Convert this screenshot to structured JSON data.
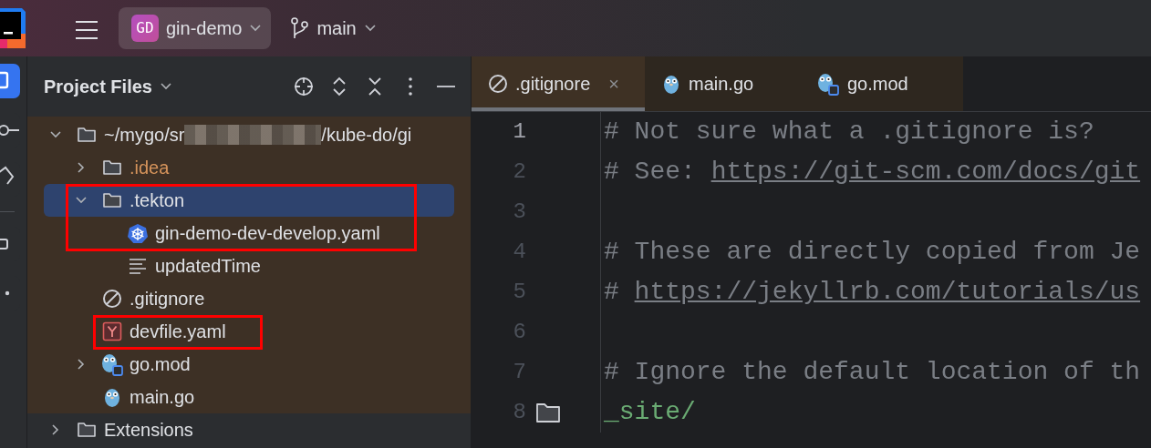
{
  "toolbar": {
    "project": {
      "badge": "GD",
      "name": "gin-demo"
    },
    "branch": "main"
  },
  "tool_strip": [
    {
      "kind": "project",
      "selected": true
    },
    {
      "kind": "commit",
      "selected": false
    },
    {
      "kind": "git",
      "selected": false
    },
    {
      "kind": "structure",
      "selected": false
    },
    {
      "kind": "more",
      "selected": false
    }
  ],
  "panel": {
    "title": "Project Files"
  },
  "tree": [
    {
      "kind": "folder",
      "label": "~/mygo/sr",
      "label_after_blur": "/kube-do/gi",
      "blurred": true,
      "scoped": true,
      "expanded": true,
      "selected": false,
      "outlined": false,
      "children": [
        {
          "kind": "folder",
          "label": ".idea",
          "ignored": true,
          "expanded": false,
          "selected": false,
          "outlined": false
        },
        {
          "kind": "folder",
          "label": ".tekton",
          "ignored": false,
          "expanded": true,
          "selected": true,
          "outlined": true,
          "children": [
            {
              "kind": "kubernetes",
              "label": "gin-demo-dev-develop.yaml",
              "ignored": false,
              "selected": false,
              "outlined": true
            },
            {
              "kind": "text",
              "label": "updatedTime",
              "ignored": false,
              "selected": false,
              "outlined": false
            }
          ]
        },
        {
          "kind": "ignore",
          "label": ".gitignore",
          "ignored": false,
          "selected": false,
          "outlined": false
        },
        {
          "kind": "yaml",
          "label": "devfile.yaml",
          "ignored": false,
          "selected": false,
          "outlined": true
        },
        {
          "kind": "gomod",
          "label": "go.mod",
          "ignored": false,
          "expanded": false,
          "selected": false,
          "outlined": false
        },
        {
          "kind": "go",
          "label": "main.go",
          "ignored": false,
          "selected": false,
          "outlined": false
        }
      ]
    },
    {
      "kind": "folder",
      "label": "Extensions",
      "scoped": false,
      "expanded": false,
      "selected": false,
      "outlined": false
    }
  ],
  "tabs": [
    {
      "kind": "ignore",
      "label": ".gitignore",
      "selected": true,
      "close": "×"
    },
    {
      "kind": "go",
      "label": "main.go",
      "selected": false
    },
    {
      "kind": "gomod",
      "label": "go.mod",
      "selected": false
    }
  ],
  "lines": [
    {
      "number": "1",
      "current": true,
      "gutter_folder": false,
      "segments": [
        {
          "kind": "comment",
          "text": "# Not sure what a .gitignore is?"
        }
      ]
    },
    {
      "number": "2",
      "current": false,
      "gutter_folder": false,
      "segments": [
        {
          "kind": "comment",
          "text": "# See: "
        },
        {
          "kind": "link",
          "text": "https://git-scm.com/docs/git"
        }
      ]
    },
    {
      "number": "3",
      "current": false,
      "gutter_folder": false
    },
    {
      "number": "4",
      "current": false,
      "gutter_folder": false,
      "segments": [
        {
          "kind": "comment",
          "text": "# These are directly copied from Je"
        }
      ]
    },
    {
      "number": "5",
      "current": false,
      "gutter_folder": false,
      "segments": [
        {
          "kind": "comment",
          "text": "# "
        },
        {
          "kind": "link",
          "text": "https://jekyllrb.com/tutorials/us"
        }
      ]
    },
    {
      "number": "6",
      "current": false,
      "gutter_folder": false
    },
    {
      "number": "7",
      "current": false,
      "gutter_folder": false,
      "segments": [
        {
          "kind": "comment",
          "text": "# Ignore the default location of th"
        }
      ]
    },
    {
      "number": "8",
      "current": false,
      "gutter_folder": true,
      "segments": [
        {
          "kind": "path",
          "text": "_site/"
        }
      ]
    }
  ]
}
